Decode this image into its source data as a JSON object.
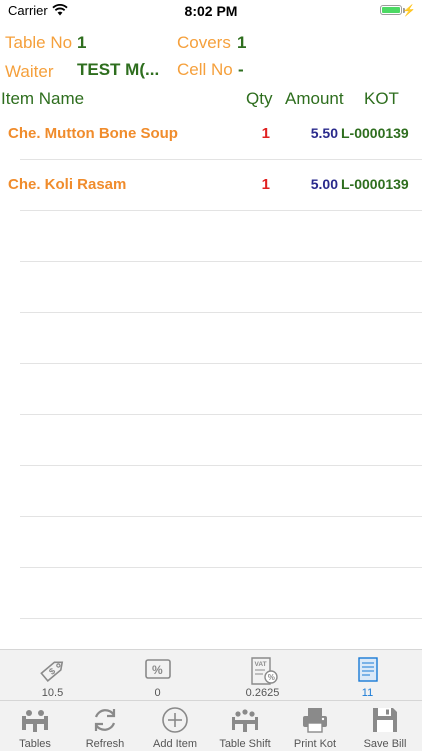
{
  "status_bar": {
    "carrier": "Carrier",
    "time": "8:02 PM",
    "battery_level": 1.0
  },
  "header": {
    "table_label": "Table No",
    "table_value": "1",
    "covers_label": "Covers",
    "covers_value": "1",
    "waiter_label": "Waiter",
    "waiter_value": "TEST M(...",
    "cell_label": "Cell No",
    "cell_value": "-"
  },
  "columns": {
    "item": "Item Name",
    "qty": "Qty",
    "amount": "Amount",
    "kot": "KOT"
  },
  "items": [
    {
      "name": "Che. Mutton Bone Soup",
      "qty": "1",
      "amount": "5.50",
      "kot": "L-0000139"
    },
    {
      "name": "Che. Koli Rasam",
      "qty": "1",
      "amount": "5.00",
      "kot": "L-0000139"
    }
  ],
  "summary": [
    {
      "icon": "price-tag-icon",
      "value": "10.5"
    },
    {
      "icon": "percent-icon",
      "value": "0"
    },
    {
      "icon": "vat-icon",
      "value": "0.2625"
    },
    {
      "icon": "receipt-icon",
      "value": "11"
    }
  ],
  "tabs": [
    {
      "icon": "tables-icon",
      "label": "Tables"
    },
    {
      "icon": "refresh-icon",
      "label": "Refresh"
    },
    {
      "icon": "add-item-icon",
      "label": "Add Item"
    },
    {
      "icon": "table-shift-icon",
      "label": "Table Shift"
    },
    {
      "icon": "printer-icon",
      "label": "Print Kot"
    },
    {
      "icon": "save-icon",
      "label": "Save Bill"
    }
  ],
  "colors": {
    "label_orange": "#f5a03c",
    "value_green": "#2e6e1e",
    "item_orange": "#f08c2c",
    "qty_red": "#e02020",
    "amount_blue": "#2a2a8c",
    "active_blue": "#1a7bd6",
    "battery_green": "#4cd964"
  }
}
